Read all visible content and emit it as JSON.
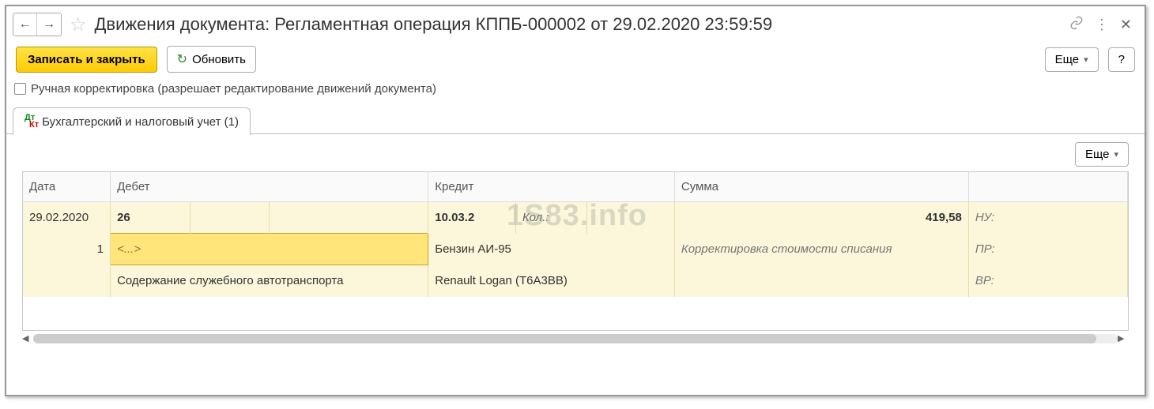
{
  "watermark": "1S83.info",
  "header": {
    "title": "Движения документа: Регламентная операция КППБ-000002 от 29.02.2020 23:59:59"
  },
  "toolbar": {
    "save_close": "Записать и закрыть",
    "refresh": "Обновить",
    "more": "Еще",
    "help": "?"
  },
  "checkbox": {
    "label": "Ручная корректировка (разрешает редактирование движений документа)"
  },
  "tabs": [
    {
      "label": "Бухгалтерский и налоговый учет (1)"
    }
  ],
  "subtoolbar": {
    "more": "Еще"
  },
  "table": {
    "columns": {
      "date": "Дата",
      "debit": "Дебет",
      "credit": "Кредит",
      "sum": "Сумма"
    },
    "rows": [
      {
        "date": "29.02.2020",
        "idx": "1",
        "debit_account": "26",
        "debit_sub1": "<...>",
        "debit_sub2": "Содержание служебного автотранспорта",
        "credit_account": "10.03.2",
        "credit_qty_lbl": "Кол.:",
        "credit_qty_val": "",
        "credit_sub1": "Бензин АИ-95",
        "credit_sub2": "Renault Logan (Т6А3ВВ)",
        "sum": "419,58",
        "desc": "Корректировка стоимости списания",
        "nu": "НУ:",
        "pr": "ПР:",
        "vr": "ВР:"
      }
    ]
  }
}
